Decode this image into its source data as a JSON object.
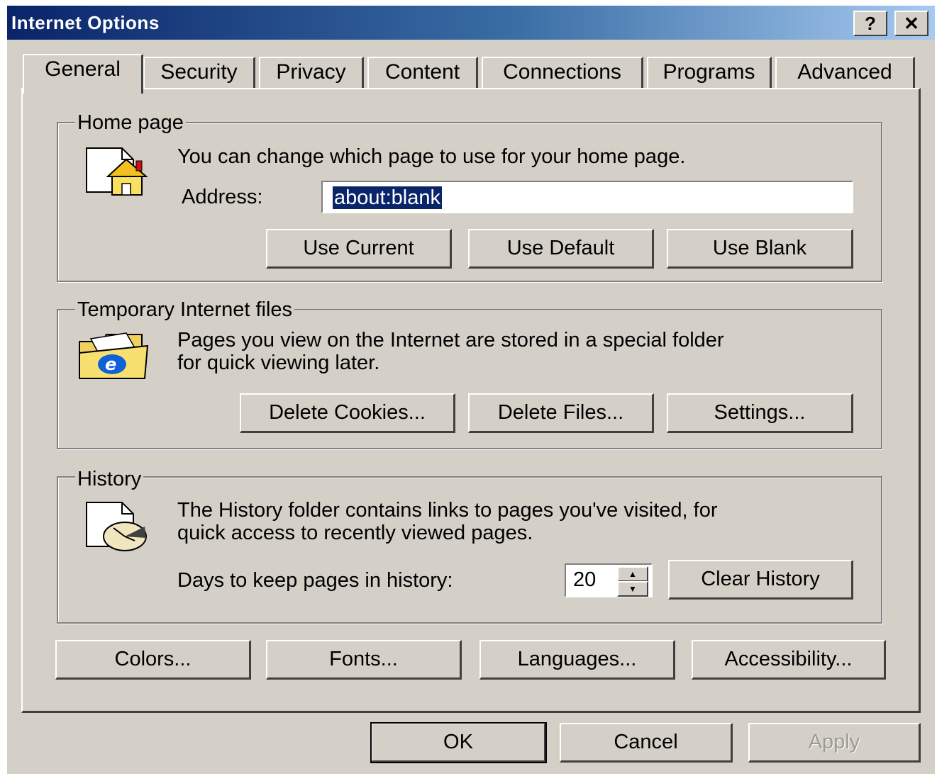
{
  "window": {
    "title": "Internet Options",
    "help_label": "?",
    "close_label": "✕"
  },
  "tabs": [
    "General",
    "Security",
    "Privacy",
    "Content",
    "Connections",
    "Programs",
    "Advanced"
  ],
  "active_tab": "General",
  "home_page": {
    "legend": "Home page",
    "description": "You can change which page to use for your home page.",
    "address_label": "Address:",
    "address_value": "about:blank",
    "buttons": {
      "use_current": "Use Current",
      "use_default": "Use Default",
      "use_blank": "Use Blank"
    },
    "icon": "home-page-icon"
  },
  "temp_files": {
    "legend": "Temporary Internet files",
    "description_line1": "Pages you view on the Internet are stored in a special folder",
    "description_line2": "for quick viewing later.",
    "buttons": {
      "delete_cookies": "Delete Cookies...",
      "delete_files": "Delete Files...",
      "settings": "Settings..."
    },
    "icon": "ie-folder-icon"
  },
  "history": {
    "legend": "History",
    "description_line1": "The History folder contains links to pages you've visited, for",
    "description_line2": "quick access to recently viewed pages.",
    "days_label": "Days to keep pages in history:",
    "days_value": "20",
    "clear_button": "Clear History",
    "icon": "history-icon"
  },
  "bottom_buttons": {
    "colors": "Colors...",
    "fonts": "Fonts...",
    "languages": "Languages...",
    "accessibility": "Accessibility..."
  },
  "dialog_buttons": {
    "ok": "OK",
    "cancel": "Cancel",
    "apply": "Apply"
  },
  "colors": {
    "titlebar_start": "#0a246a",
    "titlebar_end": "#a6caf0",
    "face": "#d4d0c8",
    "selection": "#0a246a"
  }
}
